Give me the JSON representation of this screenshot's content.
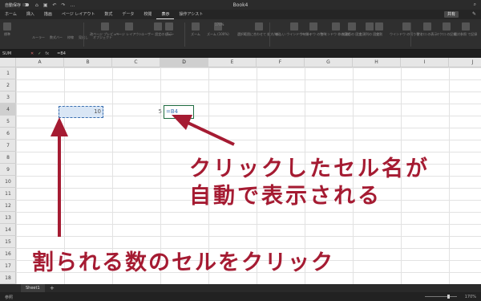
{
  "window": {
    "autosave_label": "自動保存",
    "title": "Book4"
  },
  "menu": {
    "tabs": [
      "ホーム",
      "挿入",
      "描画",
      "ページ レイアウト",
      "数式",
      "データ",
      "校閲",
      "表示",
      "操作アシスト"
    ],
    "active": "表示",
    "share_label": "共有"
  },
  "ribbon": {
    "groups": [
      {
        "label": "標準"
      },
      {
        "label": "改ページ プレビュー"
      },
      {
        "label": "ページ レイアウト"
      },
      {
        "label": "ユーザー 設定のビュー"
      },
      {
        "label": "表示"
      },
      {
        "label": "ズーム"
      },
      {
        "label": "ズーム (100%)"
      },
      {
        "label": "選択範囲に合わせて 拡大/縮小"
      },
      {
        "label": "新しい ウインドウを開く"
      },
      {
        "label": "ウインドウ の整列"
      },
      {
        "label": "ウインドウ 枠の固定"
      },
      {
        "label": "先頭行の 固定"
      },
      {
        "label": "先頭列の 固定"
      },
      {
        "label": "分割"
      },
      {
        "label": "ウインドウ の切り替え"
      },
      {
        "label": "マクロ の表示"
      },
      {
        "label": "マクロ の記録"
      },
      {
        "label": "相対参照 で記録"
      }
    ],
    "zoom_value": "170%",
    "checkboxes": [
      "ルーラー",
      "数式バー",
      "枠線",
      "見出し",
      "オブジェクト"
    ]
  },
  "formula_bar": {
    "name_box": "SUM",
    "cancel_icon": "✕",
    "enter_icon": "✓",
    "fx_label": "fx",
    "formula": "=B4"
  },
  "grid": {
    "columns": [
      "A",
      "B",
      "C",
      "D",
      "E",
      "F",
      "G",
      "H",
      "I",
      "J"
    ],
    "rows": [
      "1",
      "2",
      "3",
      "4",
      "5",
      "6",
      "7",
      "8",
      "9",
      "10",
      "11",
      "12",
      "13",
      "14",
      "15",
      "16",
      "17",
      "18"
    ],
    "selected_column": "D",
    "selected_row": "4",
    "cells": {
      "B4": "10",
      "C4": "5",
      "D4": "=B4"
    }
  },
  "sheets": {
    "tabs": [
      "Sheet1"
    ],
    "add_label": "+"
  },
  "status": {
    "mode": "参照",
    "zoom": "170%"
  },
  "annotations": {
    "line1": "クリックしたセル名が",
    "line2": "自動で表示される",
    "line3": "割られる数のセルをクリック"
  },
  "colors": {
    "annotation": "#a51b32",
    "selection_fill": "#d9e6f5",
    "active_border": "#1e6b3f"
  }
}
